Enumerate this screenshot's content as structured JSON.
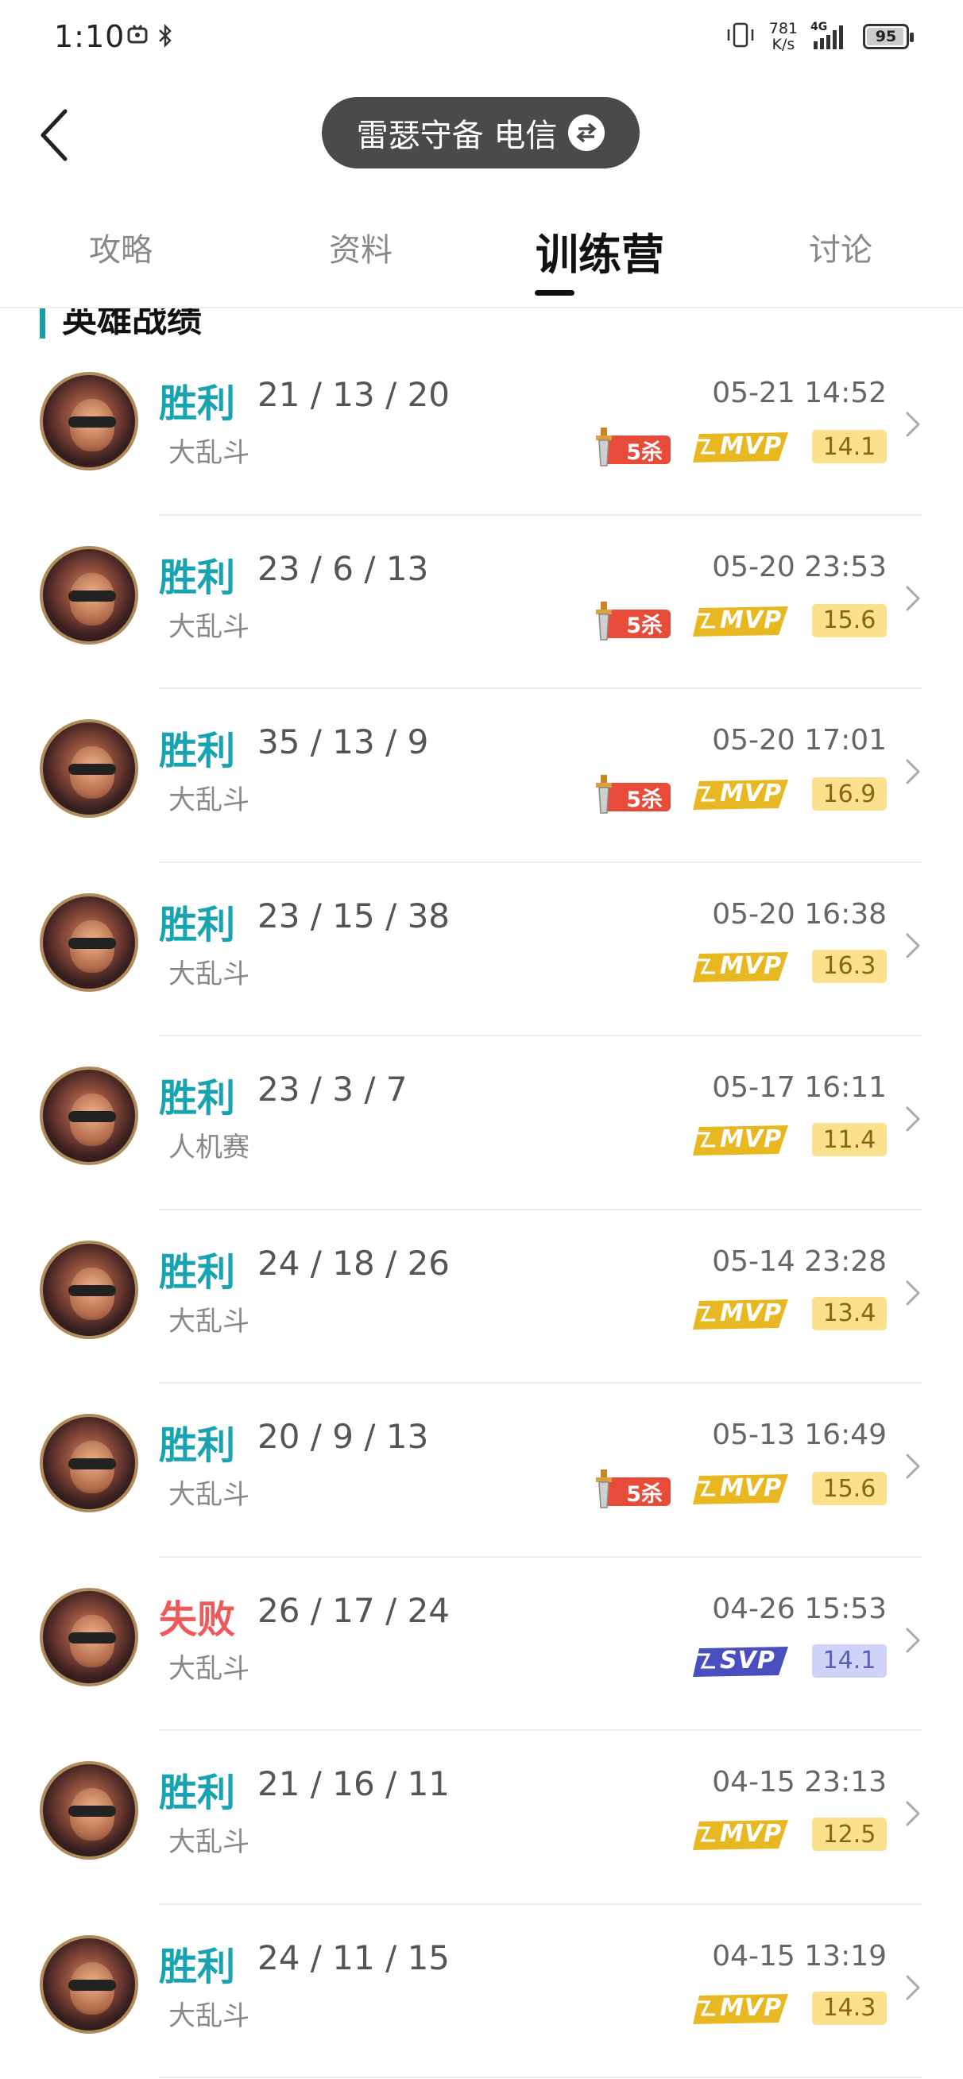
{
  "status_bar": {
    "time": "1:10",
    "net_speed_value": "781",
    "net_speed_unit": "K/s",
    "network_type": "4G",
    "battery_level": "95"
  },
  "header": {
    "server_label": "雷瑟守备 电信"
  },
  "tabs": [
    {
      "label": "攻略",
      "active": false
    },
    {
      "label": "资料",
      "active": false
    },
    {
      "label": "训练营",
      "active": true
    },
    {
      "label": "讨论",
      "active": false
    }
  ],
  "section": {
    "title": "英雄战绩"
  },
  "badge_text": {
    "five_kill": "5杀",
    "mvp": "MVP",
    "svp": "SVP"
  },
  "colors": {
    "win": "#17a3b0",
    "loss": "#ee5a5a",
    "mvp_gold": "#e8b823",
    "svp_blue": "#4a4fc0",
    "score_gold_bg": "#fbe08d",
    "score_blue_bg": "#cfd3f7"
  },
  "matches": [
    {
      "result": "胜利",
      "outcome": "win",
      "kda": "21 / 13 / 20",
      "mode": "大乱斗",
      "datetime": "05-21 14:52",
      "five_kill": true,
      "award": "mvp",
      "score": "14.1"
    },
    {
      "result": "胜利",
      "outcome": "win",
      "kda": "23 / 6 / 13",
      "mode": "大乱斗",
      "datetime": "05-20 23:53",
      "five_kill": true,
      "award": "mvp",
      "score": "15.6"
    },
    {
      "result": "胜利",
      "outcome": "win",
      "kda": "35 / 13 / 9",
      "mode": "大乱斗",
      "datetime": "05-20 17:01",
      "five_kill": true,
      "award": "mvp",
      "score": "16.9"
    },
    {
      "result": "胜利",
      "outcome": "win",
      "kda": "23 / 15 / 38",
      "mode": "大乱斗",
      "datetime": "05-20 16:38",
      "five_kill": false,
      "award": "mvp",
      "score": "16.3"
    },
    {
      "result": "胜利",
      "outcome": "win",
      "kda": "23 / 3 / 7",
      "mode": "人机赛",
      "datetime": "05-17 16:11",
      "five_kill": false,
      "award": "mvp",
      "score": "11.4"
    },
    {
      "result": "胜利",
      "outcome": "win",
      "kda": "24 / 18 / 26",
      "mode": "大乱斗",
      "datetime": "05-14 23:28",
      "five_kill": false,
      "award": "mvp",
      "score": "13.4"
    },
    {
      "result": "胜利",
      "outcome": "win",
      "kda": "20 / 9 / 13",
      "mode": "大乱斗",
      "datetime": "05-13 16:49",
      "five_kill": true,
      "award": "mvp",
      "score": "15.6"
    },
    {
      "result": "失败",
      "outcome": "loss",
      "kda": "26 / 17 / 24",
      "mode": "大乱斗",
      "datetime": "04-26 15:53",
      "five_kill": false,
      "award": "svp",
      "score": "14.1"
    },
    {
      "result": "胜利",
      "outcome": "win",
      "kda": "21 / 16 / 11",
      "mode": "大乱斗",
      "datetime": "04-15 23:13",
      "five_kill": false,
      "award": "mvp",
      "score": "12.5"
    },
    {
      "result": "胜利",
      "outcome": "win",
      "kda": "24 / 11 / 15",
      "mode": "大乱斗",
      "datetime": "04-15 13:19",
      "five_kill": false,
      "award": "mvp",
      "score": "14.3"
    }
  ]
}
